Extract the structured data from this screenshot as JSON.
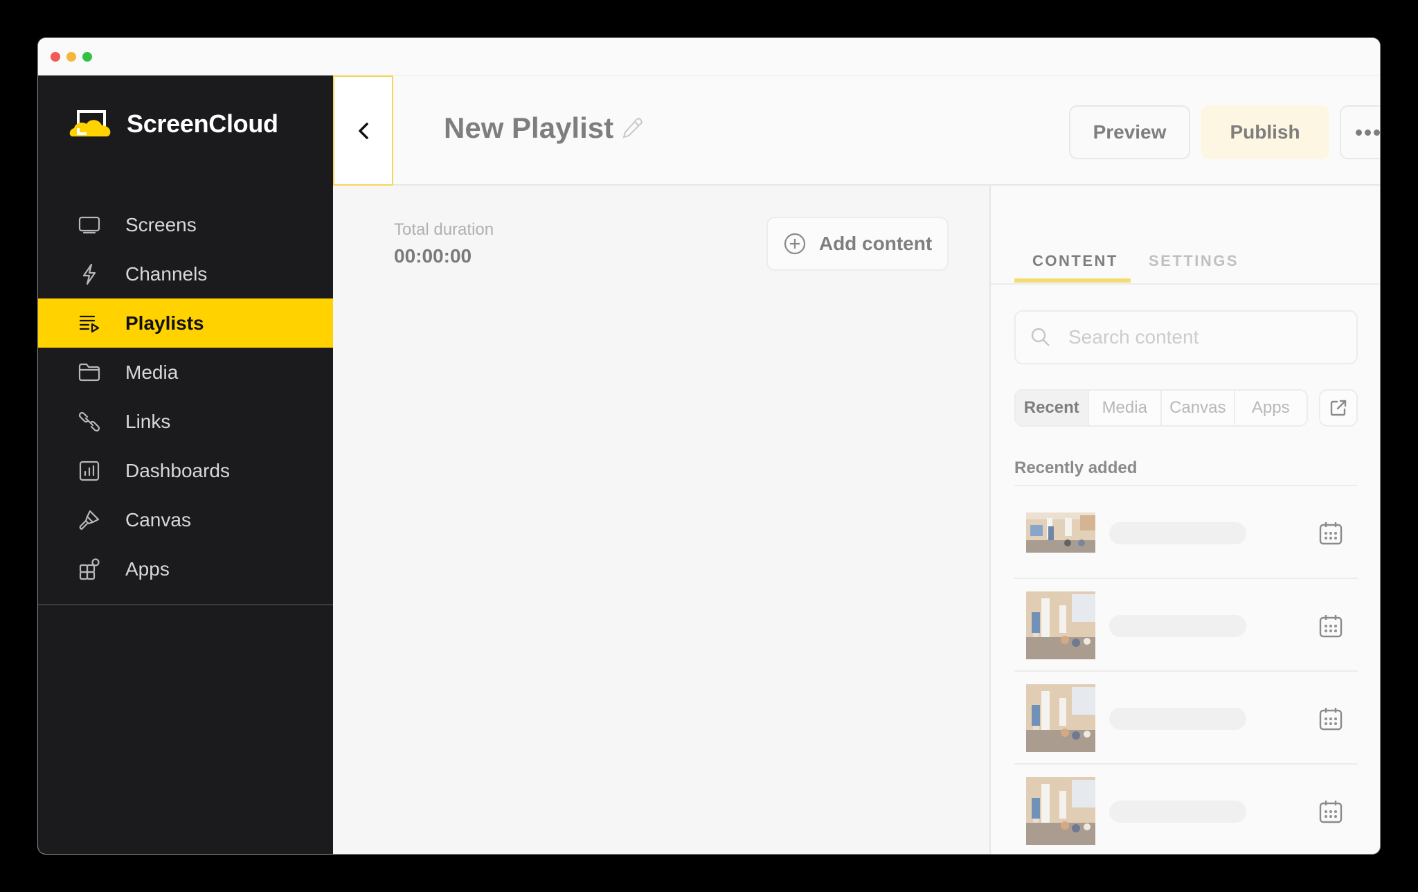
{
  "window": {
    "controls": [
      "close",
      "minimize",
      "zoom"
    ]
  },
  "sidebar": {
    "brand": "ScreenCloud",
    "brand_color": "#ffd200",
    "items": [
      {
        "label": "Screens",
        "icon": "monitor-icon",
        "active": false
      },
      {
        "label": "Channels",
        "icon": "lightning-icon",
        "active": false
      },
      {
        "label": "Playlists",
        "icon": "playlist-icon",
        "active": true
      },
      {
        "label": "Media",
        "icon": "folder-icon",
        "active": false
      },
      {
        "label": "Links",
        "icon": "link-icon",
        "active": false
      },
      {
        "label": "Dashboards",
        "icon": "dashboard-icon",
        "active": false
      },
      {
        "label": "Canvas",
        "icon": "brush-icon",
        "active": false
      },
      {
        "label": "Apps",
        "icon": "apps-icon",
        "active": false
      }
    ]
  },
  "header": {
    "back_icon": "chevron-left-icon",
    "title": "New Playlist",
    "edit_icon": "pencil-icon",
    "preview_label": "Preview",
    "publish_label": "Publish",
    "more_icon": "more-horizontal-icon"
  },
  "main": {
    "duration_label": "Total duration",
    "duration_value": "00:00:00",
    "add_content_label": "Add content"
  },
  "panel": {
    "tabs": [
      {
        "label": "CONTENT",
        "active": true
      },
      {
        "label": "SETTINGS",
        "active": false
      }
    ],
    "search_placeholder": "Search content",
    "filters": [
      {
        "label": "Recent",
        "active": true
      },
      {
        "label": "Media",
        "active": false
      },
      {
        "label": "Canvas",
        "active": false
      },
      {
        "label": "Apps",
        "active": false
      }
    ],
    "external_icon": "external-link-icon",
    "recent_title": "Recently added",
    "recent_items": [
      {
        "thumbnail": "office-presentation-photo",
        "name_loading": true,
        "icon": "calendar-icon"
      },
      {
        "thumbnail": "office-presentation-photo",
        "name_loading": true,
        "icon": "calendar-icon"
      },
      {
        "thumbnail": "office-presentation-photo",
        "name_loading": true,
        "icon": "calendar-icon"
      },
      {
        "thumbnail": "office-presentation-photo",
        "name_loading": true,
        "icon": "calendar-icon"
      }
    ]
  }
}
